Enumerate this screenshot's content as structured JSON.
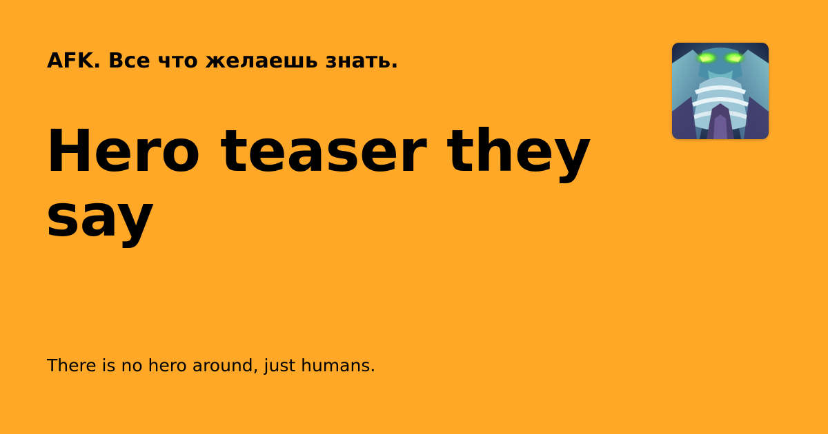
{
  "channel": {
    "name": "AFK. Все что желаешь знать."
  },
  "post": {
    "title": "Hero teaser they say",
    "excerpt": "There is no hero around, just humans."
  },
  "avatar": {
    "icon": "hero-portrait-icon"
  },
  "colors": {
    "background": "#FFA726",
    "text": "#000000",
    "avatar_eyes": "#7CFC3A",
    "avatar_body": "#3E6E8E"
  }
}
